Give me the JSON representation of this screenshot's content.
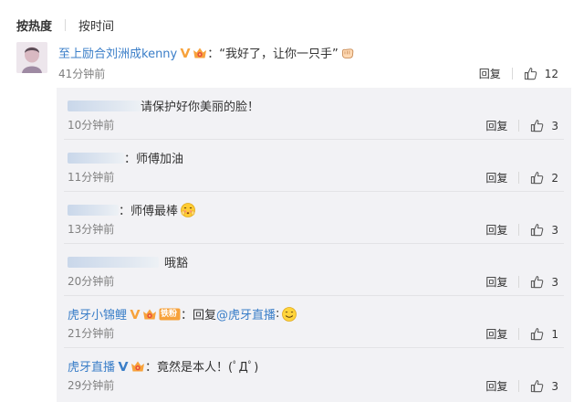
{
  "sort": {
    "active": "按热度",
    "other": "按时间"
  },
  "main_comment": {
    "user": "至上励合刘洲成kenny",
    "text": "：“我好了，让你一只手”",
    "time": "41分钟前",
    "reply": "回复",
    "likes": "12"
  },
  "replies": [
    {
      "user_blurred": true,
      "text": "请保护好你美丽的脸！",
      "time": "10分钟前",
      "reply": "回复",
      "likes": "3"
    },
    {
      "user_blurred": true,
      "text": "：师傅加油",
      "time": "11分钟前",
      "reply": "回复",
      "likes": "2"
    },
    {
      "user_blurred": true,
      "text": "：师傅最棒",
      "emoji": "shy-face-emoji",
      "time": "13分钟前",
      "reply": "回复",
      "likes": "3"
    },
    {
      "user_blurred": true,
      "text": "哦豁",
      "time": "20分钟前",
      "reply": "回复",
      "likes": "3"
    },
    {
      "user": "虎牙小锦鲤",
      "badge_text": "铁粉",
      "text_prefix": "：回复",
      "mention": "@虎牙直播",
      "text_suffix": ":",
      "emoji": "smile-emoji",
      "time": "21分钟前",
      "reply": "回复",
      "likes": "1"
    },
    {
      "user": "虎牙直播",
      "text": "：竟然是本人！(ﾟДﾟ)",
      "time": "29分钟前",
      "reply": "回复",
      "likes": "3"
    }
  ],
  "colors": {
    "link": "#3a7ec8",
    "badge_orange": "#f7a23b",
    "time_gray": "#808080",
    "sub_bg": "#f2f2f5"
  }
}
